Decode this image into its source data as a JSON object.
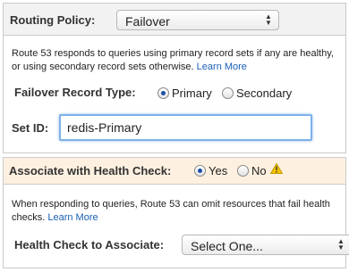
{
  "routing_policy": {
    "label": "Routing Policy:",
    "selected": "Failover"
  },
  "failover": {
    "description": "Route 53 responds to queries using primary record sets if any are healthy, or using secondary record sets otherwise.",
    "learn_more": "Learn More",
    "record_type_label": "Failover Record Type:",
    "options": [
      "Primary",
      "Secondary"
    ],
    "selected_option": "Primary",
    "set_id_label": "Set ID:",
    "set_id_value": "redis-Primary"
  },
  "health_check": {
    "label": "Associate with Health Check:",
    "options": [
      "Yes",
      "No"
    ],
    "selected_option": "Yes",
    "warning_icon": "warning-icon",
    "description": "When responding to queries, Route 53 can omit resources that fail health checks.",
    "learn_more": "Learn More",
    "associate_label": "Health Check to Associate:",
    "associate_selected": "Select One..."
  },
  "colors": {
    "link": "#1a5fb4",
    "health_header_bg": "#fdf0e0",
    "input_focus": "#7fb0e8"
  }
}
